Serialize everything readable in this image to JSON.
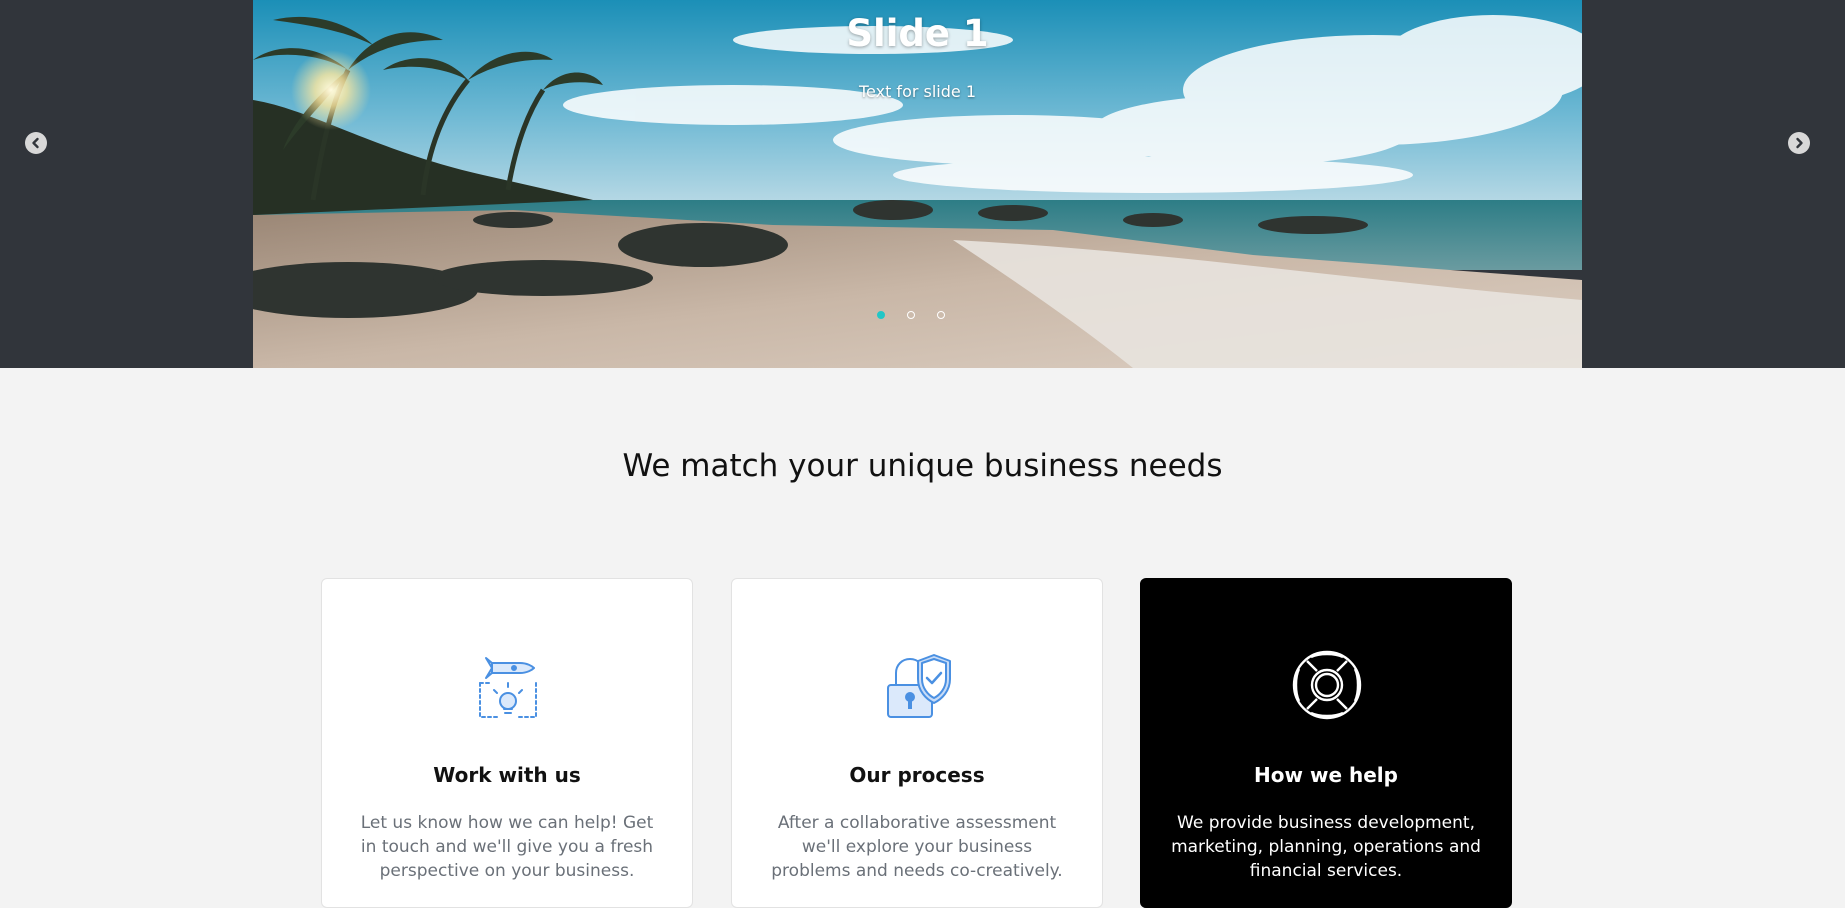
{
  "carousel": {
    "slide_title": "Slide 1",
    "slide_text": "Text for slide 1",
    "prev_icon": "chevron-left-icon",
    "next_icon": "chevron-right-icon",
    "slide_count": 3,
    "active_slide": 1,
    "active_dot_color": "#22c6c6"
  },
  "section": {
    "title": "We match your unique business needs"
  },
  "cards": [
    {
      "icon": "rocket-lightbulb-icon",
      "title": "Work with us",
      "text": "Let us know how we can help! Get in touch and we'll give you a fresh perspective on your business."
    },
    {
      "icon": "lock-shield-icon",
      "title": "Our process",
      "text": "After a collaborative assessment we'll explore your business problems and needs co-creatively."
    },
    {
      "icon": "lifebuoy-icon",
      "title": "How we help",
      "text": "We provide business development, marketing, planning, operations and financial services."
    }
  ],
  "colors": {
    "hero_background": "#31353b",
    "page_background": "#f3f3f3",
    "icon_blue": "#4a90e2"
  }
}
